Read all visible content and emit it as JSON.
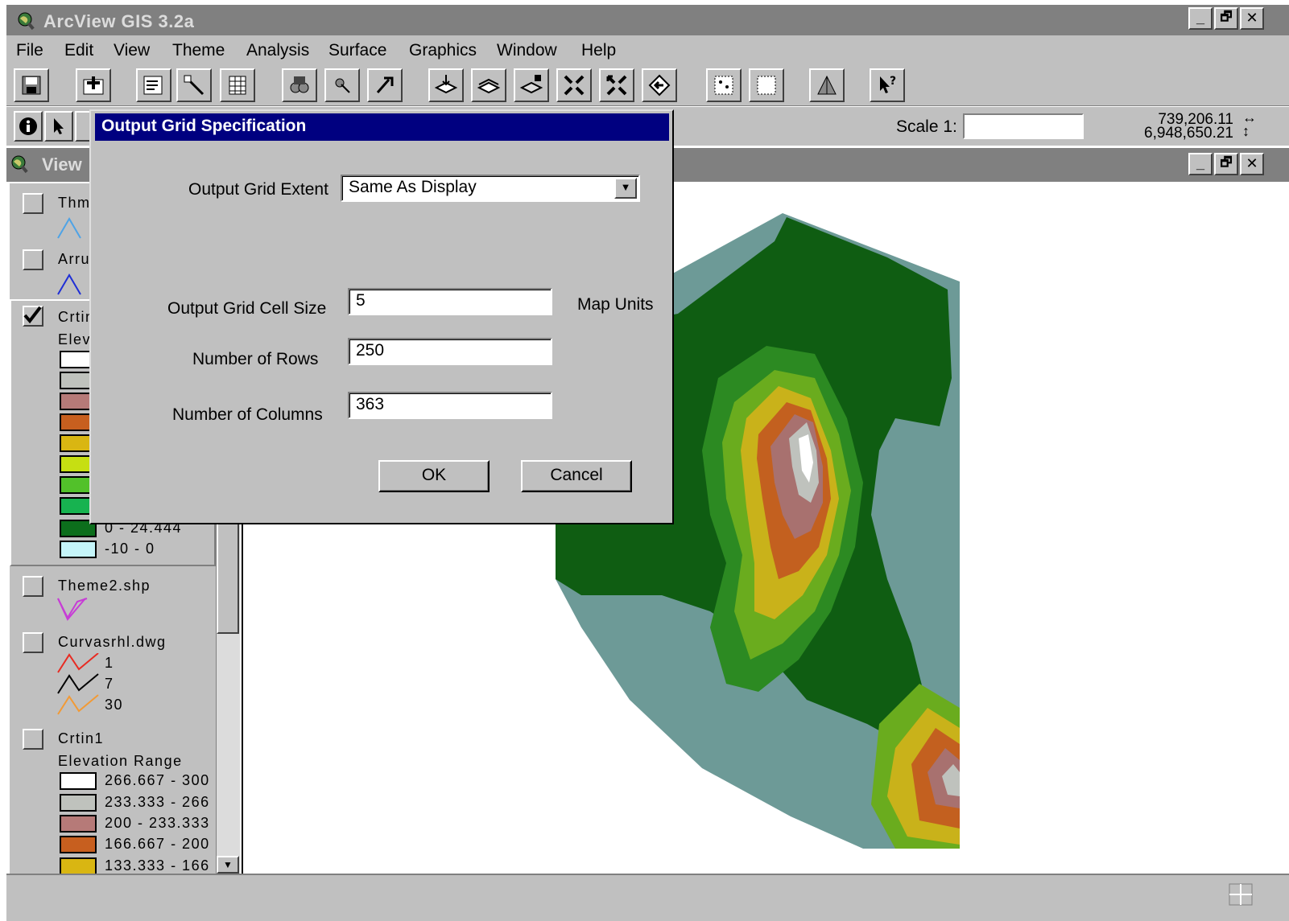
{
  "app": {
    "title": "ArcView GIS 3.2a",
    "minimize": "_",
    "restore": "🗗",
    "close": "✕"
  },
  "menu": [
    "File",
    "Edit",
    "View",
    "Theme",
    "Analysis",
    "Surface",
    "Graphics",
    "Window",
    "Help"
  ],
  "toolbar2": {
    "scale_label": "Scale 1:",
    "scale_value": "",
    "coord_x": "739,206.11",
    "coord_y": "6,948,650.21"
  },
  "view_window": {
    "title": "View",
    "minimize": "_",
    "restore": "🗗",
    "close": "✕"
  },
  "legend": {
    "theme_thm": "Thm",
    "theme_arru": "Arru",
    "theme_crtin": "Crtin",
    "crtin_sub": "Elev",
    "crtin_range_a": "0 - 24.444",
    "crtin_range_b": "-10 - 0",
    "theme2": "Theme2.shp",
    "curvas": "Curvasrhl.dwg",
    "curvas_items": [
      "1",
      "7",
      "30"
    ],
    "crtin1": "Crtin1",
    "crtin1_sub": "Elevation Range",
    "crtin1_ranges": [
      "266.667 - 300",
      "233.333 - 266",
      "200 - 233.333",
      "166.667 - 200",
      "133.333 - 166"
    ]
  },
  "dialog": {
    "title": "Output Grid Specification",
    "extent_label": "Output Grid Extent",
    "extent_value": "Same As Display",
    "cell_size_label": "Output Grid Cell Size",
    "cell_size_value": "5",
    "units_label": "Map Units",
    "rows_label": "Number of Rows",
    "rows_value": "250",
    "cols_label": "Number of Columns",
    "cols_value": "363",
    "ok": "OK",
    "cancel": "Cancel"
  },
  "colors": {
    "dialog_title_bg": "#000080",
    "window_gray": "#c0c0c0",
    "inactive_title": "#808080"
  }
}
